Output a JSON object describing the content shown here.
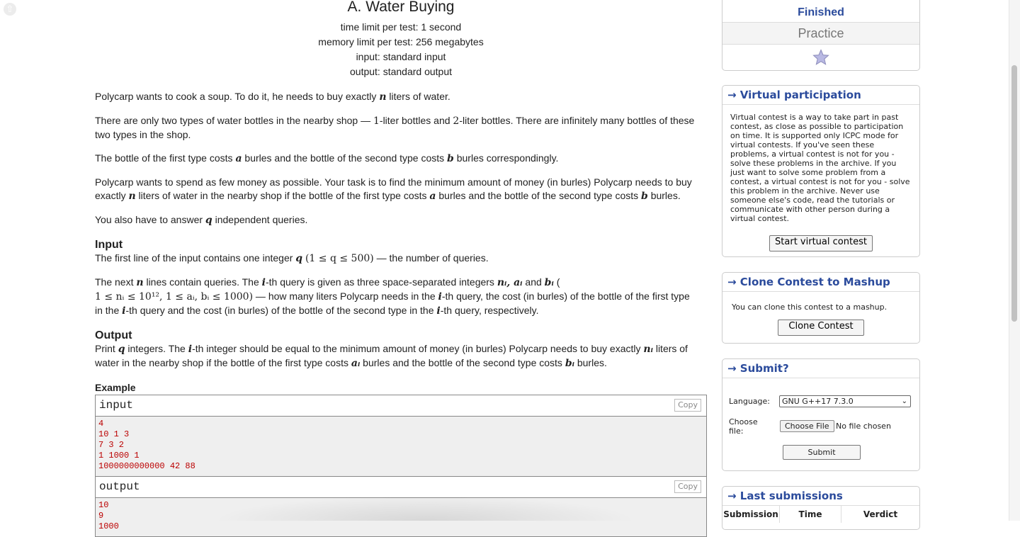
{
  "problem": {
    "title": "A. Water Buying",
    "time_limit": "time limit per test: 1 second",
    "memory_limit": "memory limit per test: 256 megabytes",
    "input_file": "input: standard input",
    "output_file": "output: standard output",
    "legend": {
      "p1_a": "Polycarp wants to cook a soup. To do it, he needs to buy exactly ",
      "p1_n": "n",
      "p1_b": " liters of water.",
      "p2_a": "There are only two types of water bottles in the nearby shop — ",
      "p2_one": "1",
      "p2_b": "-liter bottles and ",
      "p2_two": "2",
      "p2_c": "-liter bottles. There are infinitely many bottles of these two types in the shop.",
      "p3_a": "The bottle of the first type costs ",
      "p3_va": "a",
      "p3_b": " burles and the bottle of the second type costs ",
      "p3_vb": "b",
      "p3_c": " burles correspondingly.",
      "p4_a": "Polycarp wants to spend as few money as possible. Your task is to find the minimum amount of money (in burles) Polycarp needs to buy exactly ",
      "p4_n": "n",
      "p4_b": " liters of water in the nearby shop if the bottle of the first type costs ",
      "p4_va": "a",
      "p4_c": " burles and the bottle of the second type costs ",
      "p4_vb": "b",
      "p4_d": " burles.",
      "p5_a": "You also have to answer ",
      "p5_q": "q",
      "p5_b": " independent queries."
    },
    "input_spec": {
      "title": "Input",
      "l1_a": "The first line of the input contains one integer ",
      "l1_q": "q",
      "l1_range": "(1 ≤ q ≤ 500)",
      "l1_b": " — the number of queries.",
      "l2_a": "The next ",
      "l2_n": "n",
      "l2_b": " lines contain queries. The ",
      "l2_i": "i",
      "l2_c": "-th query is given as three space-separated integers ",
      "l2_vars": "nᵢ, aᵢ",
      "l2_d": " and ",
      "l2_bi": "bᵢ",
      "l2_e": " (",
      "l3_range": "1 ≤ nᵢ ≤ 10¹², 1 ≤ aᵢ, bᵢ ≤ 1000)",
      "l3_a": " — how many liters Polycarp needs in the ",
      "l3_i": "i",
      "l3_b": "-th query, the cost (in burles) of the bottle of the first type",
      "l4_a": "in the ",
      "l4_i": "i",
      "l4_b": "-th query and the cost (in burles) of the bottle of the second type in the ",
      "l4_i2": "i",
      "l4_c": "-th query, respectively."
    },
    "output_spec": {
      "title": "Output",
      "l1_a": "Print ",
      "l1_q": "q",
      "l1_b": " integers. The ",
      "l1_i": "i",
      "l1_c": "-th integer should be equal to the minimum amount of money (in burles) Polycarp needs to buy exactly ",
      "l1_ni": "nᵢ",
      "l1_d": " liters of",
      "l2_a": "water in the nearby shop if the bottle of the first type costs ",
      "l2_ai": "aᵢ",
      "l2_b": " burles and the bottle of the second type costs ",
      "l2_bi": "bᵢ",
      "l2_c": " burles."
    },
    "example": {
      "title": "Example",
      "input_label": "input",
      "output_label": "output",
      "copy_label": "Copy",
      "input_text": "4\n10 1 3\n7 3 2\n1 1000 1\n1000000000000 42 88",
      "output_text": "10\n9\n1000"
    }
  },
  "sidebar": {
    "contest_status": "Finished",
    "contest_mode": "Practice",
    "star_icon": "star-icon",
    "virtual": {
      "title": "→ Virtual participation",
      "text": "Virtual contest is a way to take part in past contest, as close as possible to participation on time. It is supported only ICPC mode for virtual contests. If you've seen these problems, a virtual contest is not for you - solve these problems in the archive. If you just want to solve some problem from a contest, a virtual contest is not for you - solve this problem in the archive. Never use someone else's code, read the tutorials or communicate with other person during a virtual contest.",
      "button": "Start virtual contest"
    },
    "clone": {
      "title": "→ Clone Contest to Mashup",
      "text": "You can clone this contest to a mashup.",
      "button": "Clone Contest"
    },
    "submit": {
      "title": "→ Submit?",
      "language_label": "Language:",
      "language_value": "GNU G++17 7.3.0",
      "file_label": "Choose file:",
      "file_button": "Choose File",
      "file_status": "No file chosen",
      "submit_button": "Submit"
    },
    "last_submissions": {
      "title": "→ Last submissions",
      "columns": [
        "Submission",
        "Time",
        "Verdict"
      ]
    }
  },
  "colors": {
    "accent": "#2b4b9c",
    "sample_text": "#bb0000",
    "sample_bg": "#efefef"
  }
}
